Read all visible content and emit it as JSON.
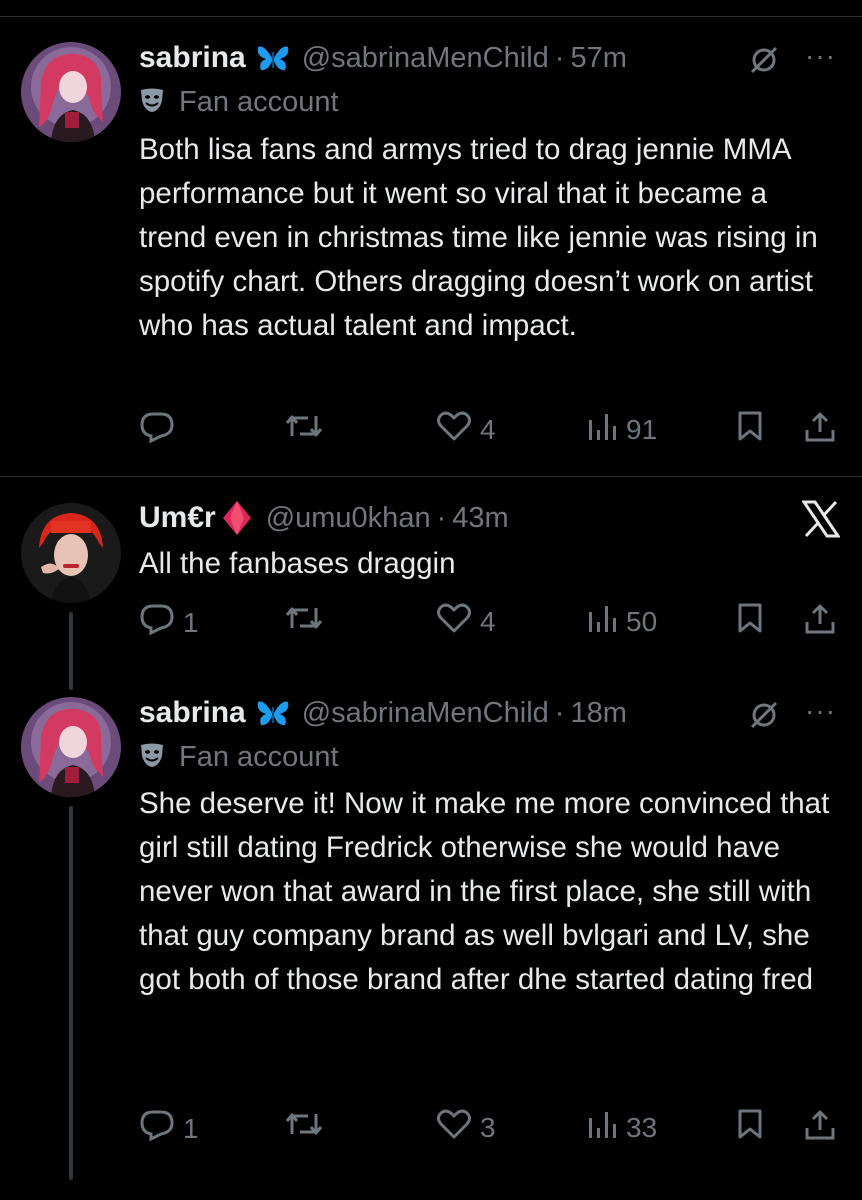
{
  "tweets": [
    {
      "name": "sabrina",
      "handle": "@sabrinaMenChild",
      "time": "57m",
      "label": "Fan account",
      "text": "Both lisa fans and armys tried to drag jennie MMA performance but it went so viral that it became a trend even in christmas time like jennie was rising in spotify chart.  Others dragging doesn’t work on artist who has actual talent and impact.",
      "replies": "",
      "retweets": "",
      "likes": "4",
      "views": "91"
    },
    {
      "name": "Um€r",
      "handle": "@umu0khan",
      "time": "43m",
      "text": "All the fanbases draggin",
      "replies": "1",
      "retweets": "",
      "likes": "4",
      "views": "50"
    },
    {
      "name": "sabrina",
      "handle": "@sabrinaMenChild",
      "time": "18m",
      "label": "Fan account",
      "text": "She deserve it! Now it make me more convinced that girl still dating Fredrick otherwise she would have never won that award in the first place, she still with that guy company brand as well bvlgari and LV, she got both of those brand after dhe started dating fred",
      "replies": "1",
      "retweets": "",
      "likes": "3",
      "views": "33"
    }
  ],
  "dot_separator": "·",
  "colors": {
    "background": "#000000",
    "text": "#e7e9ea",
    "muted": "#71767b",
    "butterfly": "#1d9bf0",
    "diamond": "#e0245e"
  },
  "icons": [
    "butterfly-icon",
    "theater-mask-icon",
    "grok-icon",
    "more-icon",
    "reply-icon",
    "retweet-icon",
    "like-icon",
    "views-icon",
    "bookmark-icon",
    "share-icon",
    "x-logo-icon",
    "diamond-icon"
  ]
}
